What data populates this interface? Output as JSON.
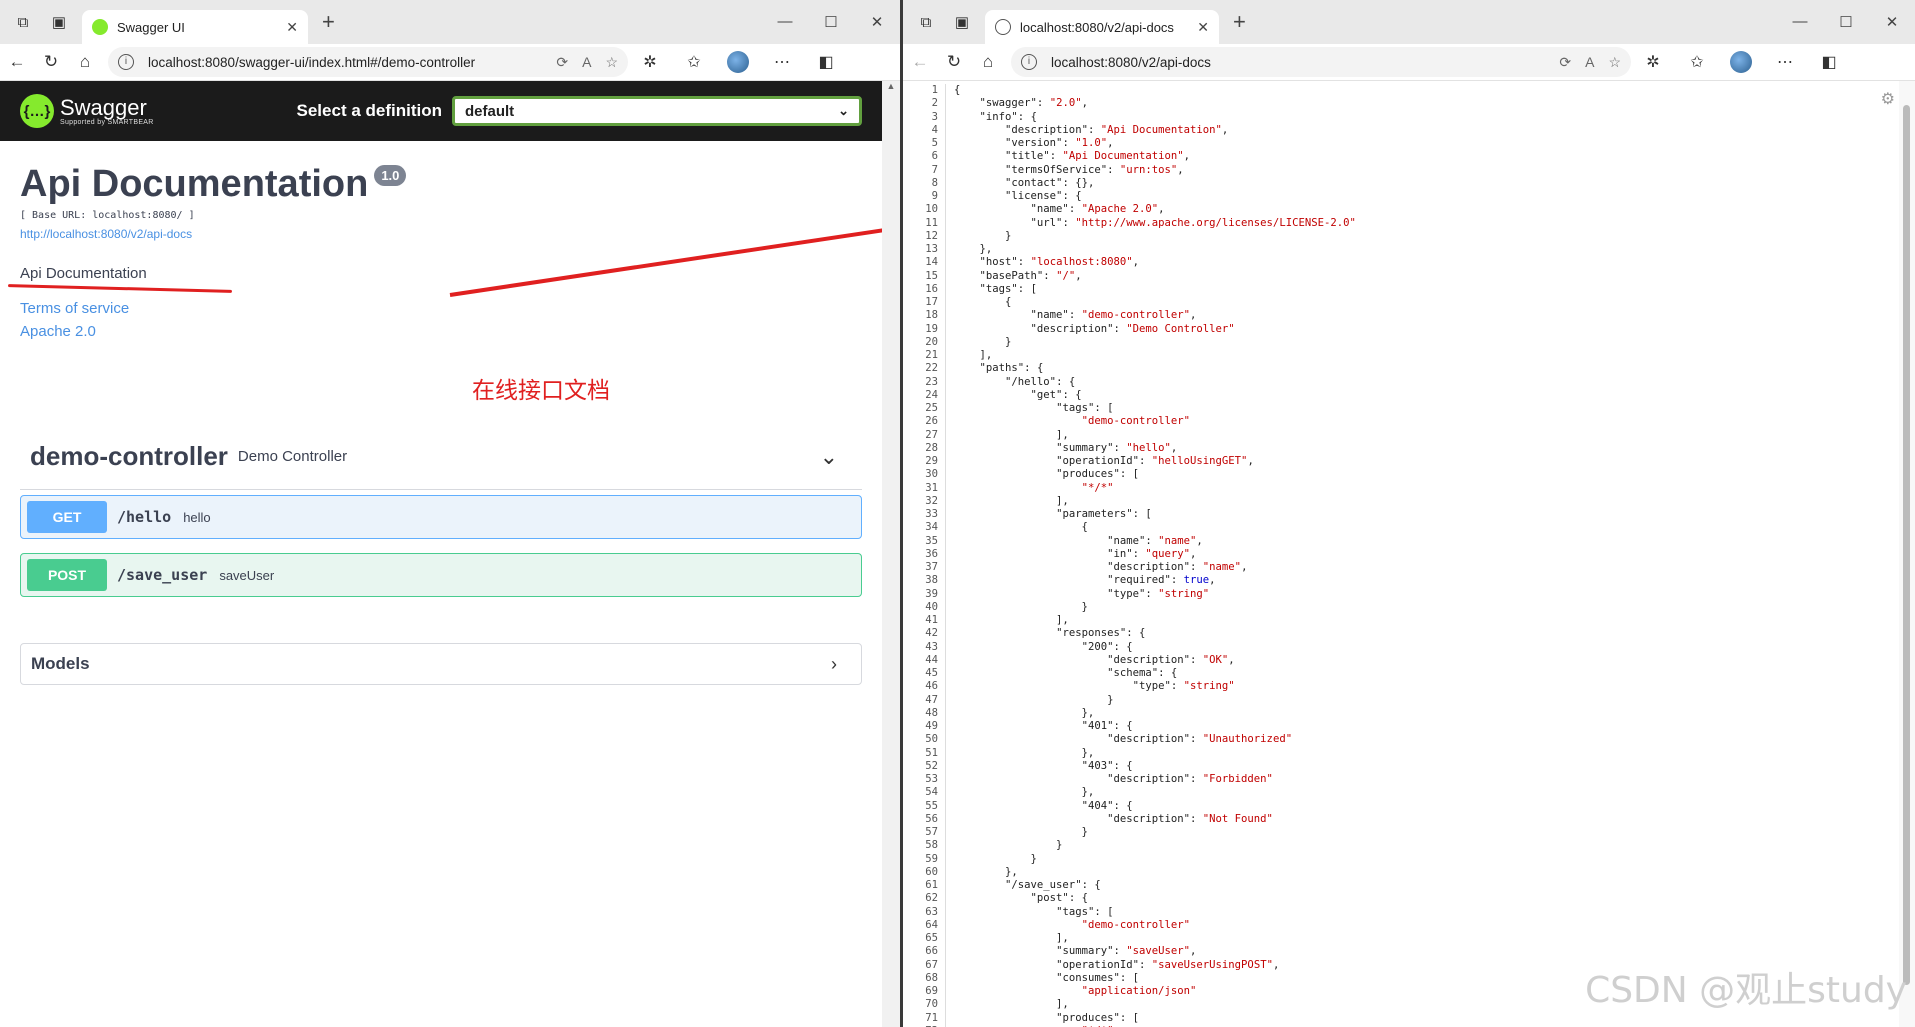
{
  "left": {
    "tab_title": "Swagger UI",
    "url": "localhost:8080/swagger-ui/index.html#/demo-controller",
    "header": {
      "logo_text": "Swagger",
      "logo_sub": "Supported by SMARTBEAR",
      "select_label": "Select a definition",
      "select_value": "default"
    },
    "info": {
      "title": "Api Documentation",
      "version": "1.0",
      "base_url": "[ Base URL: localhost:8080/ ]",
      "api_link": "http://localhost:8080/v2/api-docs",
      "description": "Api Documentation",
      "terms": "Terms of service",
      "license": "Apache 2.0"
    },
    "annotation": "在线接口文档",
    "tag": {
      "name": "demo-controller",
      "description": "Demo Controller",
      "operations": [
        {
          "method": "GET",
          "path": "/hello",
          "summary": "hello"
        },
        {
          "method": "POST",
          "path": "/save_user",
          "summary": "saveUser"
        }
      ]
    },
    "models_label": "Models"
  },
  "right": {
    "tab_title": "localhost:8080/v2/api-docs",
    "url": "localhost:8080/v2/api-docs",
    "watermark": "CSDN @观止study",
    "lines": [
      "{",
      "    \"swagger\": \"2.0\",",
      "    \"info\": {",
      "        \"description\": \"Api Documentation\",",
      "        \"version\": \"1.0\",",
      "        \"title\": \"Api Documentation\",",
      "        \"termsOfService\": \"urn:tos\",",
      "        \"contact\": {},",
      "        \"license\": {",
      "            \"name\": \"Apache 2.0\",",
      "            \"url\": \"http://www.apache.org/licenses/LICENSE-2.0\"",
      "        }",
      "    },",
      "    \"host\": \"localhost:8080\",",
      "    \"basePath\": \"/\",",
      "    \"tags\": [",
      "        {",
      "            \"name\": \"demo-controller\",",
      "            \"description\": \"Demo Controller\"",
      "        }",
      "    ],",
      "    \"paths\": {",
      "        \"/hello\": {",
      "            \"get\": {",
      "                \"tags\": [",
      "                    \"demo-controller\"",
      "                ],",
      "                \"summary\": \"hello\",",
      "                \"operationId\": \"helloUsingGET\",",
      "                \"produces\": [",
      "                    \"*/*\"",
      "                ],",
      "                \"parameters\": [",
      "                    {",
      "                        \"name\": \"name\",",
      "                        \"in\": \"query\",",
      "                        \"description\": \"name\",",
      "                        \"required\": true,",
      "                        \"type\": \"string\"",
      "                    }",
      "                ],",
      "                \"responses\": {",
      "                    \"200\": {",
      "                        \"description\": \"OK\",",
      "                        \"schema\": {",
      "                            \"type\": \"string\"",
      "                        }",
      "                    },",
      "                    \"401\": {",
      "                        \"description\": \"Unauthorized\"",
      "                    },",
      "                    \"403\": {",
      "                        \"description\": \"Forbidden\"",
      "                    },",
      "                    \"404\": {",
      "                        \"description\": \"Not Found\"",
      "                    }",
      "                }",
      "            }",
      "        },",
      "        \"/save_user\": {",
      "            \"post\": {",
      "                \"tags\": [",
      "                    \"demo-controller\"",
      "                ],",
      "                \"summary\": \"saveUser\",",
      "                \"operationId\": \"saveUserUsingPOST\",",
      "                \"consumes\": [",
      "                    \"application/json\"",
      "                ],",
      "                \"produces\": [",
      "                    \"*/*\""
    ]
  },
  "colors": {
    "swagger_green": "#85ea2d",
    "get_blue": "#61affe",
    "post_green": "#49cc90",
    "annotation_red": "#e02020",
    "json_string": "#c00000",
    "json_bool": "#0000cc"
  }
}
